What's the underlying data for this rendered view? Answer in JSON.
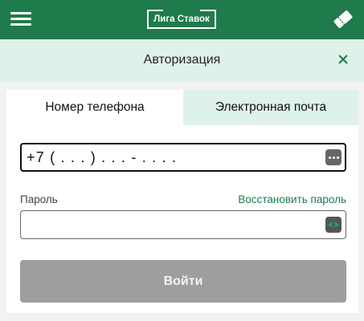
{
  "header": {
    "logo_text": "Лига Ставок",
    "menu_icon": "hamburger-menu-icon",
    "ticket_icon": "bet-ticket-icon",
    "brand_color": "#1f7a4c"
  },
  "auth": {
    "title": "Авторизация",
    "close_icon": "close-icon",
    "tabs": [
      {
        "label": "Номер телефона",
        "active": true
      },
      {
        "label": "Электронная почта",
        "active": false
      }
    ],
    "phone": {
      "value": "+7 ( . . . ) . . . - . . . ."
    },
    "password": {
      "label": "Пароль",
      "value": "",
      "restore_link": "Восстановить пароль"
    },
    "login_button": "Войти"
  }
}
